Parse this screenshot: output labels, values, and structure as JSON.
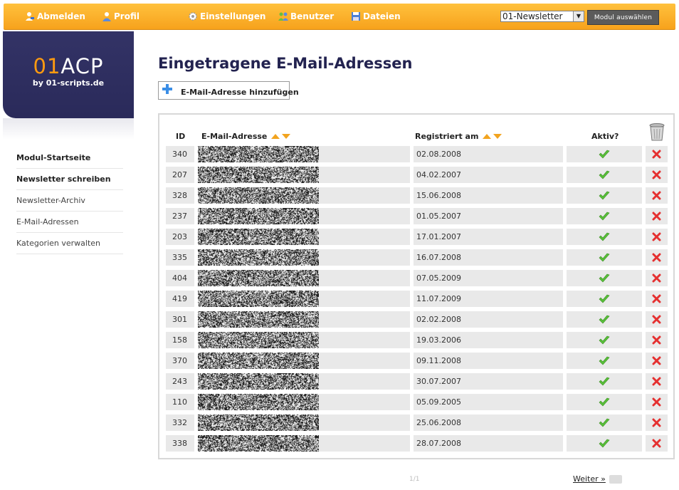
{
  "nav": {
    "logout": "Abmelden",
    "profile": "Profil",
    "settings": "Einstellungen",
    "users": "Benutzer",
    "files": "Dateien",
    "module_select": "01-Newsletter",
    "module_button": "Modul auswählen"
  },
  "logo": {
    "prefix": "01",
    "main": "ACP",
    "tagline": "by 01-scripts.de"
  },
  "sidebar": [
    {
      "label": "Modul-Startseite",
      "bold": true
    },
    {
      "label": "Newsletter schreiben",
      "bold": true
    },
    {
      "label": "Newsletter-Archiv",
      "bold": false
    },
    {
      "label": "E-Mail-Adressen",
      "bold": false
    },
    {
      "label": "Kategorien verwalten",
      "bold": false
    }
  ],
  "page": {
    "title": "Eingetragene E-Mail-Adressen",
    "add_button": "E-Mail-Adresse hinzufügen"
  },
  "table": {
    "headers": {
      "id": "ID",
      "email": "E-Mail-Adresse",
      "registered": "Registriert am",
      "active": "Aktiv?"
    },
    "rows": [
      {
        "id": "340",
        "date": "02.08.2008"
      },
      {
        "id": "207",
        "date": "04.02.2007"
      },
      {
        "id": "328",
        "date": "15.06.2008"
      },
      {
        "id": "237",
        "date": "01.05.2007"
      },
      {
        "id": "203",
        "date": "17.01.2007"
      },
      {
        "id": "335",
        "date": "16.07.2008"
      },
      {
        "id": "404",
        "date": "07.05.2009"
      },
      {
        "id": "419",
        "date": "11.07.2009"
      },
      {
        "id": "301",
        "date": "02.02.2008"
      },
      {
        "id": "158",
        "date": "19.03.2006"
      },
      {
        "id": "370",
        "date": "09.11.2008"
      },
      {
        "id": "243",
        "date": "30.07.2007"
      },
      {
        "id": "110",
        "date": "05.09.2005"
      },
      {
        "id": "332",
        "date": "25.06.2008"
      },
      {
        "id": "338",
        "date": "28.07.2008"
      }
    ]
  },
  "pagination": {
    "next": "Weiter »"
  }
}
